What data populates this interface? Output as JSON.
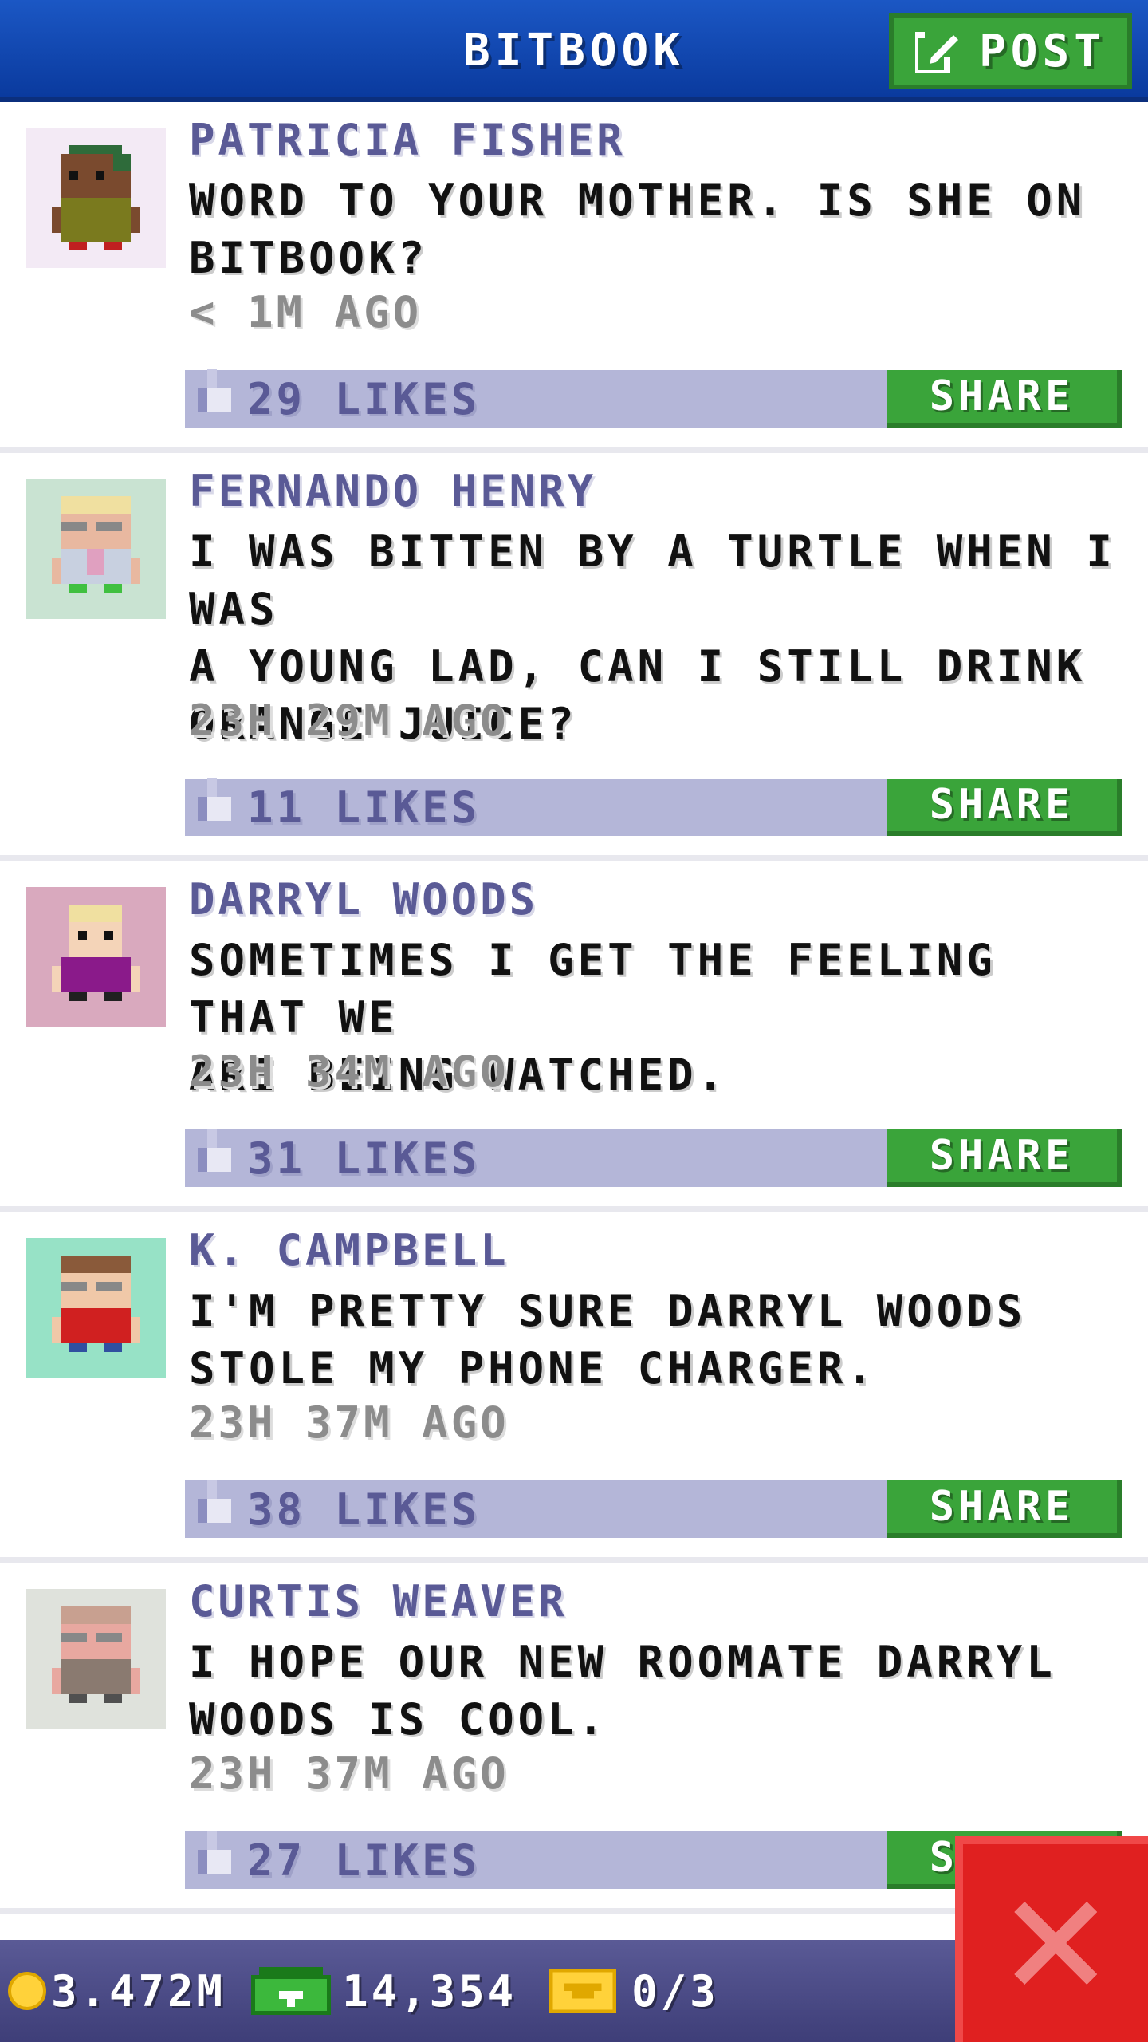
{
  "header": {
    "title": "BITBOOK",
    "post_label": "POST"
  },
  "posts": [
    {
      "author": "PATRICIA FISHER",
      "text": "WORD TO YOUR MOTHER. IS SHE ON\nBITBOOK?",
      "time": "< 1M AGO",
      "likes": "29 LIKES",
      "share": "SHARE",
      "avatar_bg": "#f3eaf5"
    },
    {
      "author": "FERNANDO HENRY",
      "text": "I WAS BITTEN BY A TURTLE WHEN I WAS\nA YOUNG LAD, CAN I STILL DRINK\nORANGE JUICE?",
      "time": "23H 29M AGO",
      "likes": "11 LIKES",
      "share": "SHARE",
      "avatar_bg": "#c9e3d2"
    },
    {
      "author": "DARRYL WOODS",
      "text": "SOMETIMES I GET THE FEELING THAT WE\nARE BEING WATCHED.",
      "time": "23H 34M AGO",
      "likes": "31 LIKES",
      "share": "SHARE",
      "avatar_bg": "#d9a9be"
    },
    {
      "author": "K. CAMPBELL",
      "text": "I'M PRETTY SURE DARRYL WOODS\nSTOLE MY PHONE CHARGER.",
      "time": "23H 37M AGO",
      "likes": "38 LIKES",
      "share": "SHARE",
      "avatar_bg": "#97e2c6"
    },
    {
      "author": "CURTIS WEAVER",
      "text": "I HOPE OUR NEW ROOMATE DARRYL\nWOODS IS COOL.",
      "time": "23H 37M AGO",
      "likes": "27 LIKES",
      "share": "SHARE",
      "avatar_bg": "#dfe2dc"
    }
  ],
  "footer": {
    "coins": "3.472M",
    "bux": "14,354",
    "vip": "0/3"
  },
  "colors": {
    "header": "#1b57c4",
    "accent_green": "#3aa43a",
    "like_bar": "#b4b6d8",
    "author": "#5a5a96",
    "close": "#e02020"
  }
}
